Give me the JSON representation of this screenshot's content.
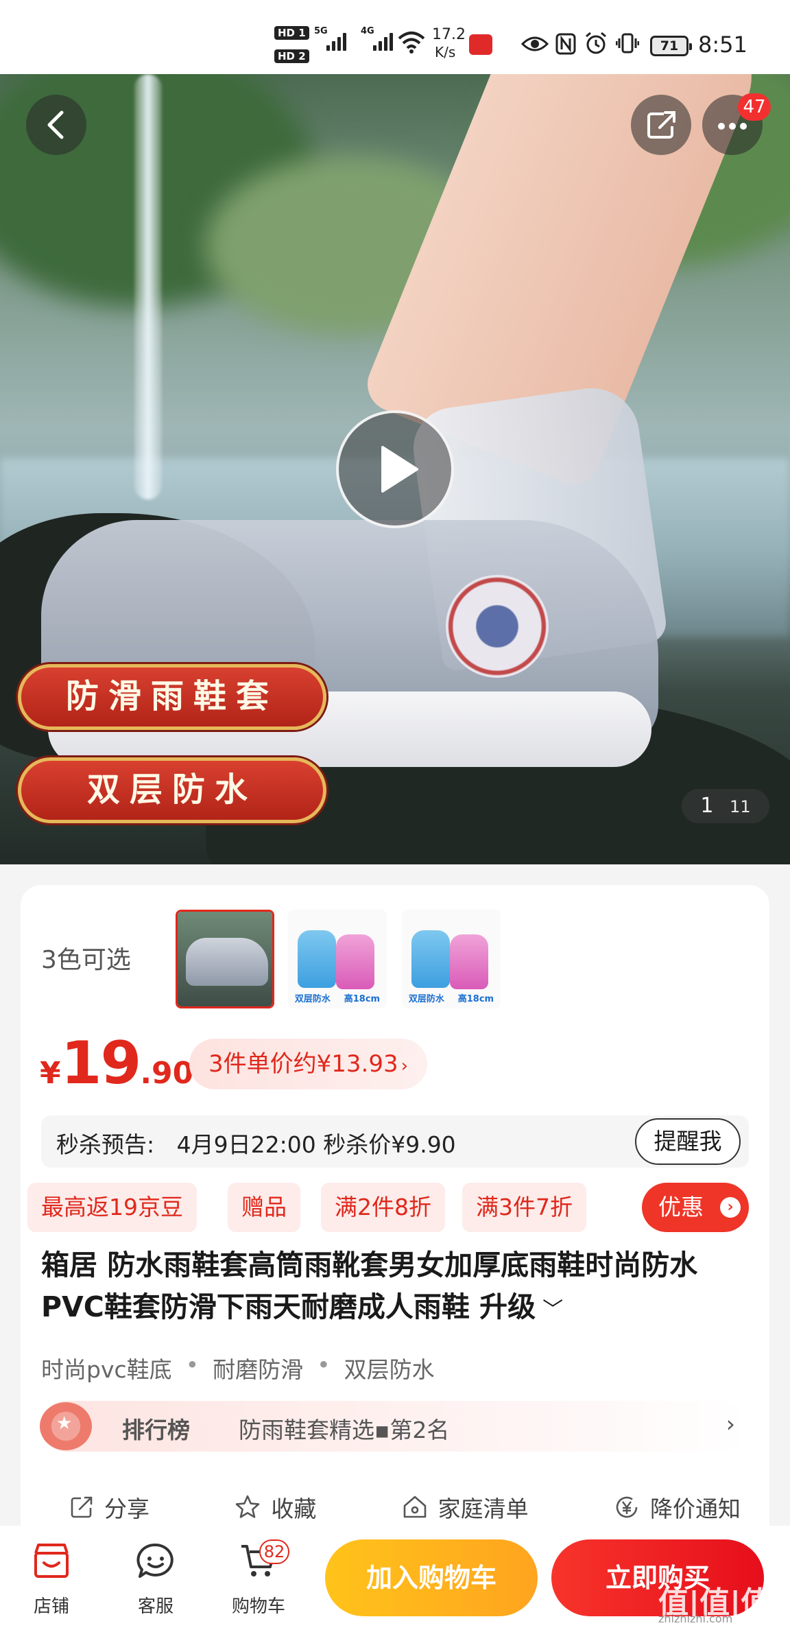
{
  "status_bar": {
    "network_speed": "17.2",
    "network_unit": "K/s",
    "battery": "71",
    "time": "8:51"
  },
  "hero": {
    "badge_count": "47",
    "ribbon_1": "防滑雨鞋套",
    "ribbon_2": "双层防水",
    "image_index": "1",
    "image_total": "11"
  },
  "product": {
    "colors_label": "3色可选",
    "thumb_caption_1": "双层防水",
    "thumb_caption_2": "高18cm",
    "price_currency": "¥",
    "price_int": "19",
    "price_dec": ".90",
    "multi_price": "3件单价约¥13.93",
    "seckill_label": "秒杀预告:",
    "seckill_text": "4月9日22:00 秒杀价¥9.90",
    "remind_button": "提醒我",
    "tags": [
      "最高返19京豆",
      "赠品",
      "满2件8折",
      "满3件7折"
    ],
    "coupon_button": "优惠",
    "title": "箱居 防水雨鞋套高筒雨靴套男女加厚底雨鞋时尚防水PVC鞋套防滑下雨天耐磨成人雨鞋 升级",
    "features": [
      "时尚pvc鞋底",
      "耐磨防滑",
      "双层防水"
    ],
    "rank_key": "排行榜",
    "rank_value": "防雨鞋套精选▪第2名"
  },
  "actions": {
    "share": "分享",
    "favorite": "收藏",
    "family_list": "家庭清单",
    "price_alert": "降价通知"
  },
  "bottom_bar": {
    "store": "店铺",
    "service": "客服",
    "cart": "购物车",
    "cart_count": "82",
    "add_to_cart": "加入购物车",
    "buy_now": "立即购买"
  },
  "watermark": {
    "main": "值|值|值",
    "url": "zhizhizhi.com"
  },
  "colors": {
    "accent_red": "#e0281c",
    "cart_yellow": "#ffb01f"
  }
}
